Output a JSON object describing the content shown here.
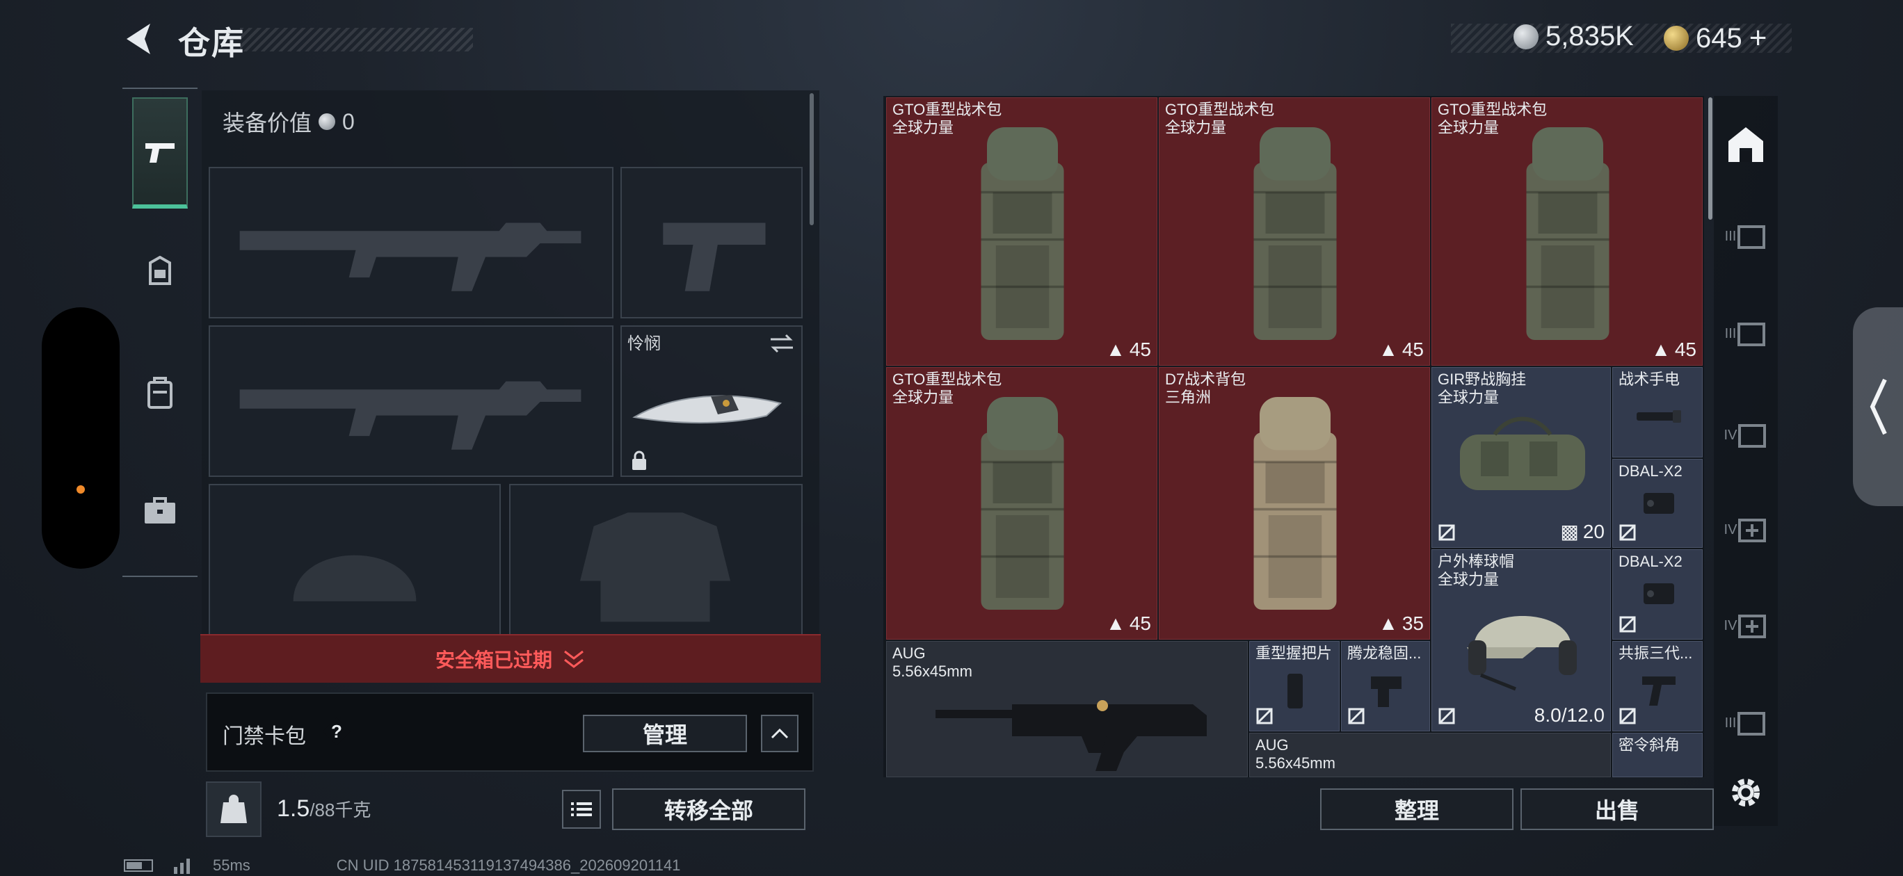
{
  "header": {
    "title": "仓库",
    "currency_primary": "5,835K",
    "currency_secondary": "645",
    "currency_add": "+"
  },
  "left_tabs": [
    "weapons",
    "gear",
    "backpack",
    "case"
  ],
  "loadout": {
    "equip_value_label": "装备价值",
    "equip_value": "0",
    "melee_name": "怜悯",
    "expired_notice": "安全箱已过期",
    "keycard_label": "门禁卡包",
    "keycard_help": "?",
    "manage_button": "管理",
    "weight_current": "1.5",
    "weight_max": "/88千克",
    "transfer_all_button": "转移全部",
    "weight_icon_text": "KG"
  },
  "stash": {
    "items": [
      {
        "name": "GTO重型战术包",
        "sub": "全球力量",
        "count": "45",
        "color": "red"
      },
      {
        "name": "GTO重型战术包",
        "sub": "全球力量",
        "count": "45",
        "color": "red"
      },
      {
        "name": "GTO重型战术包",
        "sub": "全球力量",
        "count": "45",
        "color": "red"
      },
      {
        "name": "GTO重型战术包",
        "sub": "全球力量",
        "count": "45",
        "color": "red"
      },
      {
        "name": "D7战术背包",
        "sub": "三角洲",
        "count": "35",
        "color": "red"
      },
      {
        "name": "GIR野战胸挂",
        "sub": "全球力量",
        "count": "20",
        "color": "blue"
      },
      {
        "name": "战术手电",
        "sub": "",
        "count": "",
        "color": "blue"
      },
      {
        "name": "DBAL-X2",
        "sub": "",
        "count": "",
        "color": "blue"
      },
      {
        "name": "户外棒球帽",
        "sub": "全球力量",
        "count": "8.0/12.0",
        "color": "blue"
      },
      {
        "name": "DBAL-X2",
        "sub": "",
        "count": "",
        "color": "blue"
      },
      {
        "name": "AUG",
        "sub": "5.56x45mm",
        "count": "",
        "color": "dark"
      },
      {
        "name": "重型握把片",
        "sub": "",
        "count": "",
        "color": "blue"
      },
      {
        "name": "腾龙稳固...",
        "sub": "",
        "count": "",
        "color": "blue"
      },
      {
        "name": "共振三代...",
        "sub": "",
        "count": "",
        "color": "blue"
      },
      {
        "name": "AUG",
        "sub": "5.56x45mm",
        "count": "",
        "color": "dark"
      },
      {
        "name": "密令斜角",
        "sub": "",
        "count": "",
        "color": "blue"
      }
    ],
    "sort_button": "整理",
    "sell_button": "出售"
  },
  "right_rail": [
    "III",
    "III",
    "IV",
    "IV",
    "IV",
    "III"
  ],
  "status": {
    "ping": "55ms",
    "uid": "CN UID 1875814531191374943​86_202609201141"
  },
  "colors": {
    "accent": "#4cc29a",
    "rare_red": "#5c1f24",
    "epic_blue": "#323a4d",
    "warning": "#ff5a5a"
  }
}
